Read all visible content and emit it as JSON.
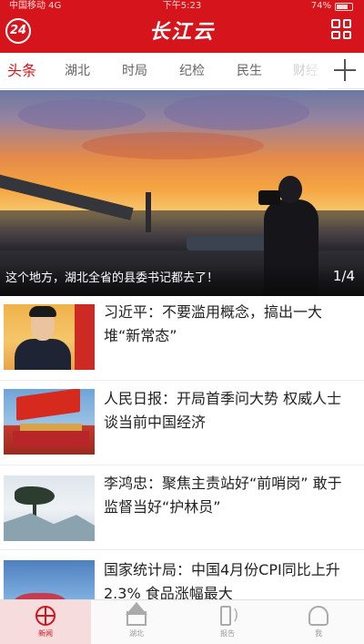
{
  "status_bar": {
    "carrier": "中国移动 4G",
    "time": "下午5:23",
    "battery": "74%"
  },
  "header": {
    "news24_label": "24",
    "logo_text": "长江云"
  },
  "tabs": [
    {
      "label": "头条",
      "active": true
    },
    {
      "label": "湖北"
    },
    {
      "label": "时局"
    },
    {
      "label": "纪检"
    },
    {
      "label": "民生"
    },
    {
      "label": "财经"
    }
  ],
  "hero": {
    "title": "这个地方，湖北全省的县委书记都去了！",
    "page": "1/4"
  },
  "articles": [
    {
      "title": "习近平：不要滥用概念，搞出一大堆“新常态”"
    },
    {
      "title": "人民日报：开局首季问大势 权威人士谈当前中国经济"
    },
    {
      "title": "李鸿忠：聚焦主责站好“前哨岗” 敢于监督当好“护林员”"
    },
    {
      "title": "国家统计局：中国4月份CPI同比上升2.3% 食品涨幅最大"
    }
  ],
  "bottom_nav": [
    {
      "label": "新闻",
      "icon": "globe-icon",
      "active": true
    },
    {
      "label": "湖北",
      "icon": "home-icon"
    },
    {
      "label": "报告",
      "icon": "speaker-icon"
    },
    {
      "label": "我",
      "icon": "user-icon"
    }
  ],
  "colors": {
    "brand_red": "#d6141c",
    "tab_active": "#d6141c",
    "text": "#222222"
  }
}
